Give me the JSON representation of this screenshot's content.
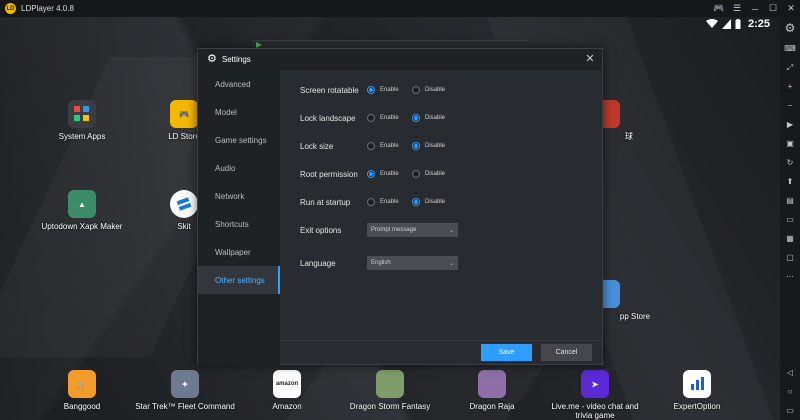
{
  "window": {
    "title": "LDPlayer 4.0.8",
    "logo_text": "LD"
  },
  "status": {
    "time": "2:25"
  },
  "desktop_apps": [
    {
      "label": "System Apps",
      "icon": "system-apps-icon",
      "color": "#3a3d42"
    },
    {
      "label": "LD Store",
      "icon": "ld-store-icon",
      "color": "#f5b800"
    },
    {
      "label": "Uptodown Xapk Maker",
      "icon": "uptodown-icon",
      "color": "#3c8c6a"
    },
    {
      "label": "Skit",
      "icon": "skit-icon",
      "color": "#1b78d6"
    },
    {
      "label": "球",
      "icon": "partial-app-icon",
      "color": "#c0392b"
    },
    {
      "label": "pp Store",
      "icon": "partial-store-icon",
      "color": "#4a90d9"
    }
  ],
  "dock_apps": [
    {
      "label": "Banggood",
      "icon": "banggood-icon",
      "color": "#f39c2a"
    },
    {
      "label": "Star Trek™ Fleet Command",
      "icon": "star-trek-icon",
      "color": "#6d7a90"
    },
    {
      "label": "Amazon",
      "icon": "amazon-icon",
      "color": "#ffffff",
      "text": "amazon"
    },
    {
      "label": "Dragon Storm Fantasy",
      "icon": "dragon-storm-icon",
      "color": "#7f9d6b"
    },
    {
      "label": "Dragon Raja",
      "icon": "dragon-raja-icon",
      "color": "#8e6fa8"
    },
    {
      "label": "Live.me - video chat and trivia game",
      "icon": "liveme-icon",
      "color": "#5b2ad6"
    },
    {
      "label": "ExpertOption",
      "icon": "expertoption-icon",
      "color": "#ffffff"
    }
  ],
  "settings": {
    "title": "Settings",
    "nav": [
      "Advanced",
      "Model",
      "Game settings",
      "Audio",
      "Network",
      "Shortcuts",
      "Wallpaper",
      "Other settings"
    ],
    "active_nav": "Other settings",
    "options": [
      {
        "label": "Screen rotatable",
        "enable": "Enable",
        "disable": "Disable",
        "selected": "enable"
      },
      {
        "label": "Lock landscape",
        "enable": "Enable",
        "disable": "Disable",
        "selected": "disable"
      },
      {
        "label": "Lock size",
        "enable": "Enable",
        "disable": "Disable",
        "selected": "disable"
      },
      {
        "label": "Root permission",
        "enable": "Enable",
        "disable": "Disable",
        "selected": "enable"
      },
      {
        "label": "Run at startup",
        "enable": "Enable",
        "disable": "Disable",
        "selected": "disable"
      }
    ],
    "exit_options": {
      "label": "Exit options",
      "value": "Prompt message"
    },
    "language": {
      "label": "Language",
      "value": "English"
    },
    "save_label": "Save",
    "cancel_label": "Cancel"
  },
  "colors": {
    "accent": "#2f9cff",
    "dialog_bg": "#282b2f",
    "nav_bg": "#1f2225"
  }
}
